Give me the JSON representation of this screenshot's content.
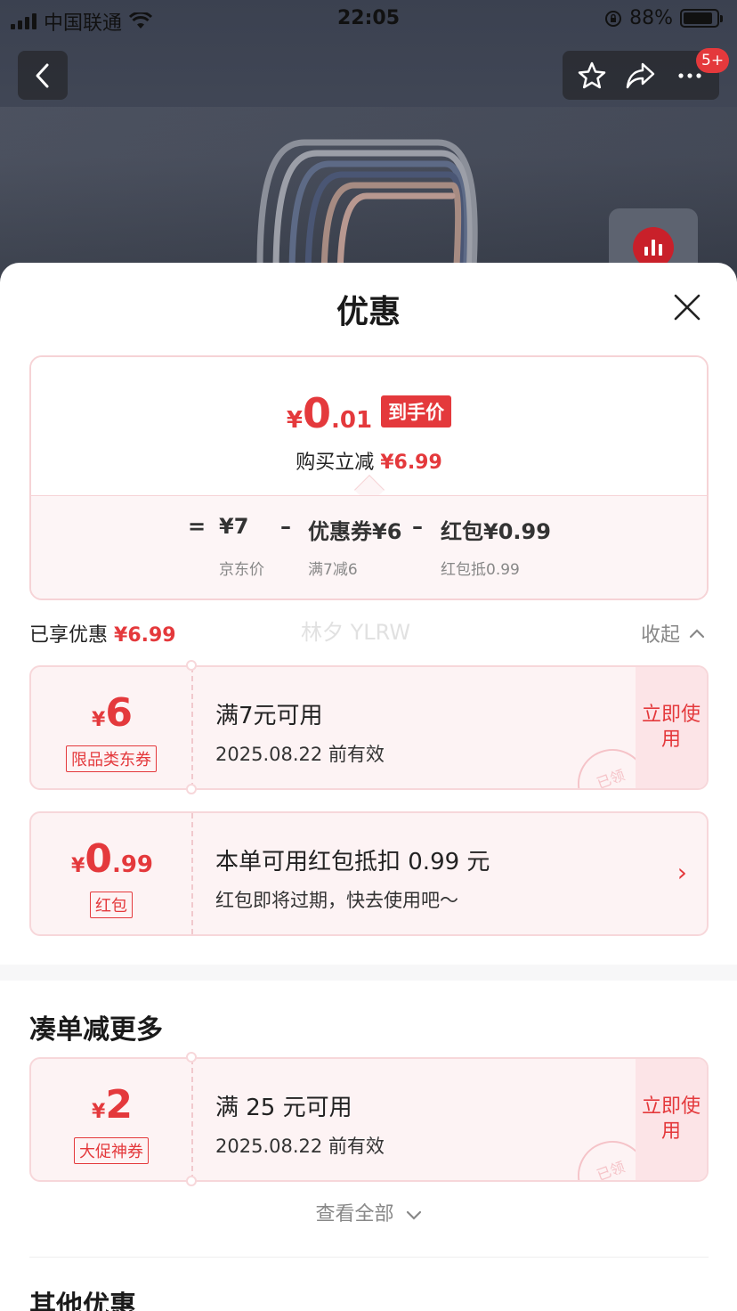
{
  "status_bar": {
    "carrier": "中国联通",
    "time": "22:05",
    "battery": "88%",
    "battery_level": 0.88
  },
  "nav": {
    "badge": "5+"
  },
  "sheet": {
    "title": "优惠"
  },
  "summary": {
    "price_yen": "¥",
    "price_int": "0",
    "price_dec": ".01",
    "price_tag": "到手价",
    "reduce_label": "购买立减",
    "reduce_amount": "¥6.99",
    "calc": {
      "eq": "=",
      "jd_price": "¥7",
      "jd_price_label": "京东价",
      "minus1": "–",
      "coupon": "优惠券¥6",
      "coupon_label": "满7减6",
      "minus2": "–",
      "redpack": "红包¥0.99",
      "redpack_label": "红包抵0.99"
    }
  },
  "enjoyed": {
    "label": "已享优惠",
    "amount": "¥6.99",
    "collapse": "收起"
  },
  "watermark": "林夕 YLRW",
  "coupons": [
    {
      "yen": "¥",
      "int": "6",
      "dec": "",
      "type": "限品类东券",
      "main": "满7元可用",
      "sub": "2025.08.22 前有效",
      "action": "立即使用",
      "stamp": "已领"
    },
    {
      "yen": "¥",
      "int": "0",
      "dec": ".99",
      "type": "红包",
      "main": "本单可用红包抵扣 0.99 元",
      "sub": "红包即将过期，快去使用吧～",
      "arrow": "›"
    }
  ],
  "more_section": {
    "title": "凑单减更多",
    "coupon": {
      "yen": "¥",
      "int": "2",
      "type": "大促神券",
      "main": "满 25 元可用",
      "sub": "2025.08.22 前有效",
      "action": "立即使用",
      "stamp": "已领"
    },
    "see_all": "查看全部"
  },
  "other_section": {
    "title": "其他优惠"
  },
  "colors": {
    "accent": "#e4393c",
    "coupon_bg": "#fdf3f4",
    "coupon_border": "#f7d7da"
  }
}
